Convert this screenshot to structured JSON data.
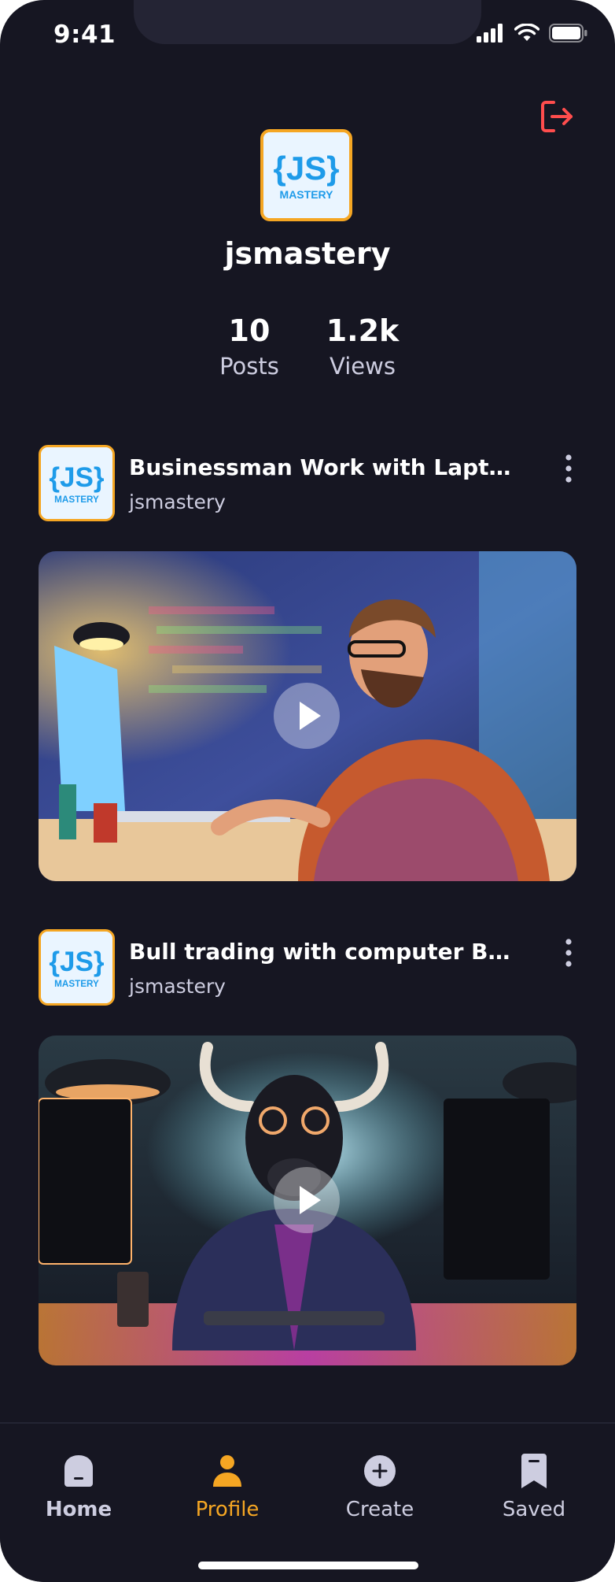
{
  "status": {
    "time": "9:41"
  },
  "profile": {
    "logo_top": "{JS}",
    "logo_bottom": "MASTERY",
    "username": "jsmastery",
    "stats": [
      {
        "value": "10",
        "label": "Posts"
      },
      {
        "value": "1.2k",
        "label": "Views"
      }
    ]
  },
  "posts": [
    {
      "title": "Businessman Work with Laptop...",
      "author": "jsmastery"
    },
    {
      "title": "Bull trading with computer Bullis...",
      "author": "jsmastery"
    }
  ],
  "tabs": [
    {
      "label": "Home",
      "icon": "home-icon"
    },
    {
      "label": "Profile",
      "icon": "profile-icon"
    },
    {
      "label": "Create",
      "icon": "plus-icon"
    },
    {
      "label": "Saved",
      "icon": "bookmark-icon"
    }
  ],
  "colors": {
    "background": "#161622",
    "accent": "#F5A623",
    "logout": "#FF4D4D",
    "muted_text": "#CDCDE0"
  }
}
